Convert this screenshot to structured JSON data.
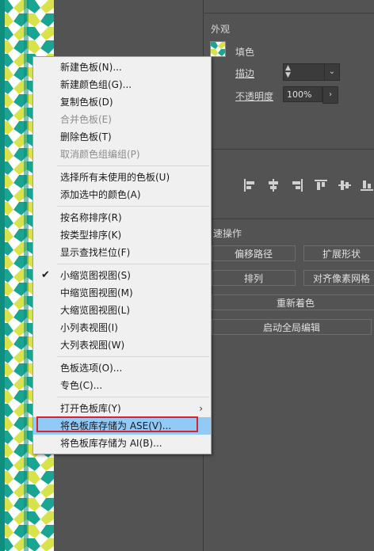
{
  "panel": {
    "appearance_title": "外观",
    "fill_label": "填色",
    "stroke_label": "描边",
    "opacity_label": "不透明度",
    "opacity_value": "100%",
    "quick_actions_title": "速操作",
    "buttons": {
      "offset_path": "偏移路径",
      "expand_shape": "扩展形状",
      "arrange": "排列",
      "align_pixel": "对齐像素网格",
      "recolor": "重新着色",
      "global_edit": "启动全局编辑"
    }
  },
  "menu": {
    "items": [
      {
        "label": "新建色板(N)..."
      },
      {
        "label": "新建颜色组(G)..."
      },
      {
        "label": "复制色板(D)"
      },
      {
        "label": "合并色板(E)"
      },
      {
        "label": "删除色板(T)"
      },
      {
        "label": "取消颜色组编组(P)"
      },
      {
        "label": "选择所有未使用的色板(U)"
      },
      {
        "label": "添加选中的颜色(A)"
      },
      {
        "label": "按名称排序(R)"
      },
      {
        "label": "按类型排序(K)"
      },
      {
        "label": "显示查找栏位(F)"
      },
      {
        "label": "小缩览图视图(S)"
      },
      {
        "label": "中缩览图视图(M)"
      },
      {
        "label": "大缩览图视图(L)"
      },
      {
        "label": "小列表视图(I)"
      },
      {
        "label": "大列表视图(W)"
      },
      {
        "label": "色板选项(O)..."
      },
      {
        "label": "专色(C)..."
      },
      {
        "label": "打开色板库(Y)"
      },
      {
        "label": "将色板库存储为 ASE(V)..."
      },
      {
        "label": "将色板库存储为 AI(B)..."
      }
    ],
    "check_glyph": "✔",
    "submenu_glyph": "›"
  },
  "colors": {
    "highlight": "#91c9f7",
    "annotation": "#d9232a",
    "pattern_teal": "#1aa592",
    "pattern_yellow": "#d8e24a"
  }
}
